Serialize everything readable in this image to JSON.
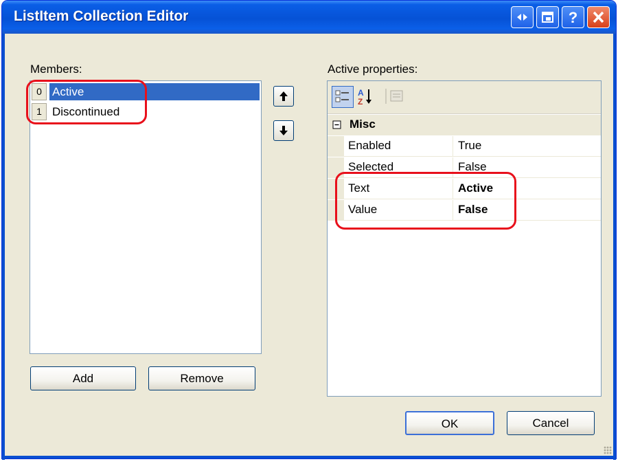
{
  "window": {
    "title": "ListItem Collection Editor",
    "buttons": [
      "context-help-arrows",
      "restore",
      "help",
      "close"
    ]
  },
  "members": {
    "label": "Members:",
    "items": [
      {
        "index": "0",
        "text": "Active",
        "selected": true
      },
      {
        "index": "1",
        "text": "Discontinued",
        "selected": false
      }
    ],
    "add_label": "Add",
    "remove_label": "Remove"
  },
  "properties": {
    "label": "Active properties:",
    "category": "Misc",
    "rows": [
      {
        "name": "Enabled",
        "value": "True",
        "bold": false
      },
      {
        "name": "Selected",
        "value": "False",
        "bold": false
      },
      {
        "name": "Text",
        "value": "Active",
        "bold": true
      },
      {
        "name": "Value",
        "value": "False",
        "bold": true
      }
    ]
  },
  "footer": {
    "ok_label": "OK",
    "cancel_label": "Cancel"
  },
  "colors": {
    "titlebar": "#0652d6",
    "selection": "#316ac5",
    "annotation": "#e8101b",
    "dialog_bg": "#ece9d8"
  }
}
